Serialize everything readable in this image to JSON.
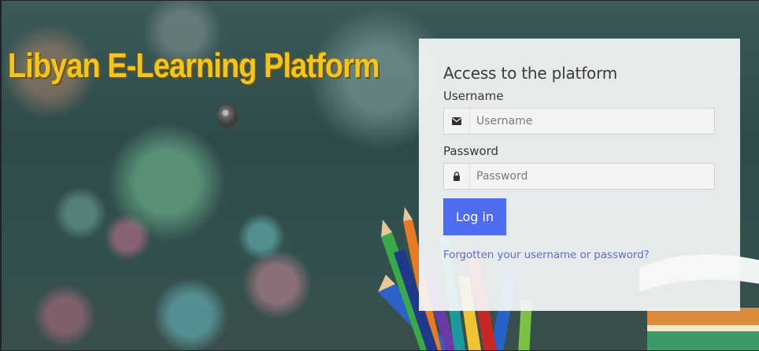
{
  "site": {
    "title": "Libyan E-Learning Platform"
  },
  "login": {
    "heading": "Access to the platform",
    "username_label": "Username",
    "username_placeholder": "Username",
    "password_label": "Password",
    "password_placeholder": "Password",
    "submit_label": "Log in",
    "forgot_link": "Forgotten your username or password?"
  },
  "icons": {
    "username_icon": "envelope-icon",
    "password_icon": "lock-icon"
  },
  "colors": {
    "title": "#f2c521",
    "button": "#4e6cf0",
    "link": "#5a6ee0"
  }
}
